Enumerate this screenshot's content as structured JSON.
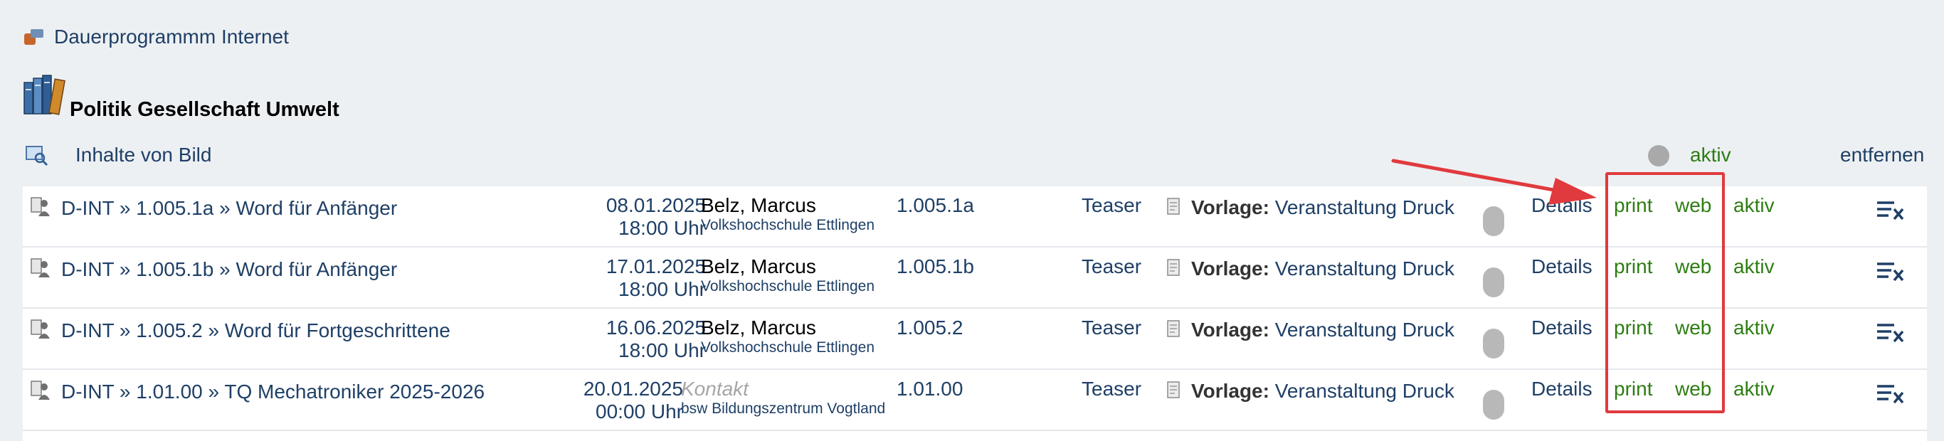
{
  "program": {
    "icon": "folder-books-icon",
    "title": "Dauerprogrammm Internet"
  },
  "section": {
    "icon": "books-icon",
    "title": "Politik Gesellschaft Umwelt"
  },
  "header_row": {
    "icon": "picture-search-icon",
    "link": "Inhalte von Bild",
    "status_dot_color": "#a9a9a9",
    "aktiv_label": "aktiv",
    "remove_label": "entfernen"
  },
  "rows": [
    {
      "prefix": "D-INT",
      "code": "1.005.1a",
      "course": "Word für Anfänger",
      "date": "08.01.2025",
      "time": "18:00 Uhr",
      "person": "Belz, Marcus",
      "org": "Volkshochschule Ettlingen",
      "course_nr": "1.005.1a",
      "teaser": "Teaser",
      "vorlage_label": "Vorlage:",
      "vorlage_value": "Veranstaltung Druck",
      "details": "Details",
      "print": "print",
      "web": "web",
      "aktiv": "aktiv"
    },
    {
      "prefix": "D-INT",
      "code": "1.005.1b",
      "course": "Word für Anfänger",
      "date": "17.01.2025",
      "time": "18:00 Uhr",
      "person": "Belz, Marcus",
      "org": "Volkshochschule Ettlingen",
      "course_nr": "1.005.1b",
      "teaser": "Teaser",
      "vorlage_label": "Vorlage:",
      "vorlage_value": "Veranstaltung Druck",
      "details": "Details",
      "print": "print",
      "web": "web",
      "aktiv": "aktiv"
    },
    {
      "prefix": "D-INT",
      "code": "1.005.2",
      "course": "Word für Fortgeschrittene",
      "date": "16.06.2025",
      "time": "18:00 Uhr",
      "person": "Belz, Marcus",
      "org": "Volkshochschule Ettlingen",
      "course_nr": "1.005.2",
      "teaser": "Teaser",
      "vorlage_label": "Vorlage:",
      "vorlage_value": "Veranstaltung Druck",
      "details": "Details",
      "print": "print",
      "web": "web",
      "aktiv": "aktiv"
    },
    {
      "prefix": "D-INT",
      "code": "1.01.00",
      "course": "TQ Mechatroniker 2025-2026",
      "date": "20.01.2025",
      "time": "00:00 Uhr",
      "contact_placeholder": "Kontakt",
      "org": "bsw Bildungszentrum Vogtland",
      "course_nr": "1.01.00",
      "teaser": "Teaser",
      "vorlage_label": "Vorlage:",
      "vorlage_value": "Veranstaltung Druck",
      "details": "Details",
      "print": "print",
      "web": "web",
      "aktiv": "aktiv"
    }
  ],
  "colors": {
    "background": "#edf0f3",
    "link": "#1f3f66",
    "active_green": "#2d7d12",
    "annotation_red": "#e03a3e"
  }
}
